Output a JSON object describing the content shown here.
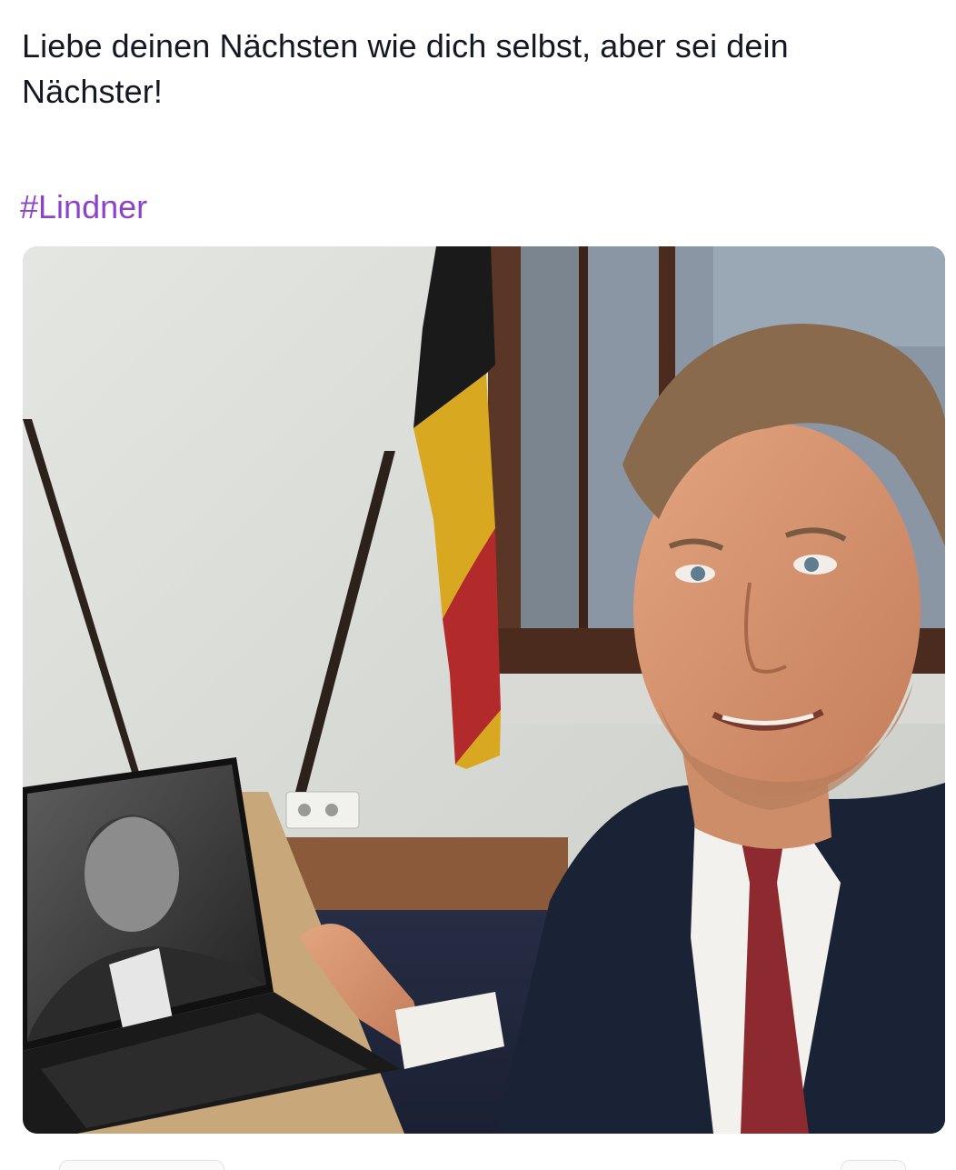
{
  "post": {
    "text_lines": [
      "Liebe deinen Nächsten wie dich selbst, aber sei dein",
      "Nächster!"
    ],
    "hashtag": "#Lindner",
    "colors": {
      "text": "#141823",
      "hashtag": "#8b44c9",
      "background": "#ffffff"
    }
  },
  "media": {
    "icon": "photo-icon"
  }
}
